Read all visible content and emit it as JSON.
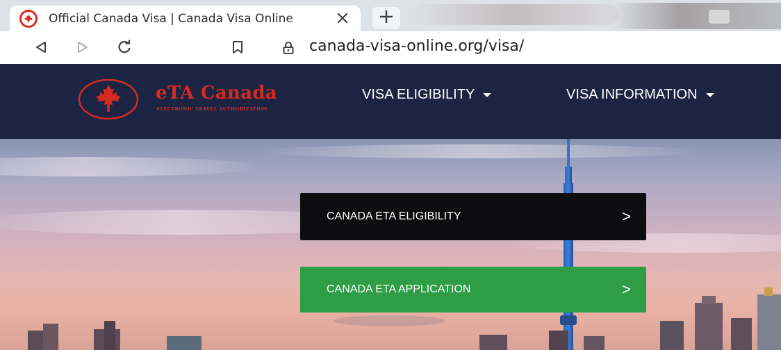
{
  "browser": {
    "tab": {
      "title": "Official Canada Visa | Canada Visa Online",
      "favicon": "canada-maple-leaf-icon",
      "close_icon": "close-icon"
    },
    "new_tab_icon": "plus-icon",
    "toolbar": {
      "back_icon": "back-icon",
      "forward_icon": "forward-icon",
      "reload_icon": "reload-icon",
      "bookmark_icon": "bookmark-icon",
      "lock_icon": "lock-icon",
      "url": "canada-visa-online.org/visa/"
    }
  },
  "site": {
    "brand": {
      "name": "eTA Canada",
      "tagline": "ELECTRONIC TRAVEL AUTHORIZATION",
      "logo_icon": "maple-leaf-icon",
      "color": "#d52b1e"
    },
    "nav": [
      {
        "label": "VISA ELIGIBILITY",
        "icon": "caret-down-icon"
      },
      {
        "label": "VISA INFORMATION",
        "icon": "caret-down-icon"
      }
    ],
    "header_color": "#1b2443"
  },
  "hero": {
    "buttons": [
      {
        "label": "CANADA ETA ELIGIBILITY",
        "arrow": ">",
        "color": "#0d0d0f"
      },
      {
        "label": "CANADA ETA APPLICATION",
        "arrow": ">",
        "color": "#2e9d45"
      }
    ]
  }
}
